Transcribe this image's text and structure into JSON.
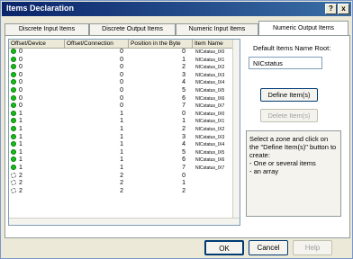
{
  "window": {
    "title": "Items Declaration",
    "help_glyph": "?",
    "close_glyph": "x"
  },
  "tabs": [
    {
      "label": "Discrete Input Items"
    },
    {
      "label": "Discrete Output Items"
    },
    {
      "label": "Numeric Input Items"
    },
    {
      "label": "Numeric Output Items"
    }
  ],
  "active_tab": "Numeric Output Items",
  "grid": {
    "columns": [
      "Offset/Device",
      "Offset/Connection",
      "Position in the Byte",
      "Item Name"
    ],
    "rows": [
      {
        "status": "green",
        "device": "0",
        "conn": "0",
        "pos": "0",
        "name": "NICstatus_IX0"
      },
      {
        "status": "green",
        "device": "0",
        "conn": "0",
        "pos": "1",
        "name": "NICstatus_IX1"
      },
      {
        "status": "green",
        "device": "0",
        "conn": "0",
        "pos": "2",
        "name": "NICstatus_IX2"
      },
      {
        "status": "green",
        "device": "0",
        "conn": "0",
        "pos": "3",
        "name": "NICstatus_IX3"
      },
      {
        "status": "green",
        "device": "0",
        "conn": "0",
        "pos": "4",
        "name": "NICstatus_IX4"
      },
      {
        "status": "green",
        "device": "0",
        "conn": "0",
        "pos": "5",
        "name": "NICstatus_IX5"
      },
      {
        "status": "green",
        "device": "0",
        "conn": "0",
        "pos": "6",
        "name": "NICstatus_IX6"
      },
      {
        "status": "green",
        "device": "0",
        "conn": "0",
        "pos": "7",
        "name": "NICstatus_IX7"
      },
      {
        "status": "green",
        "device": "1",
        "conn": "1",
        "pos": "0",
        "name": "NICstatus_IX0"
      },
      {
        "status": "green",
        "device": "1",
        "conn": "1",
        "pos": "1",
        "name": "NICstatus_IX1"
      },
      {
        "status": "green",
        "device": "1",
        "conn": "1",
        "pos": "2",
        "name": "NICstatus_IX2"
      },
      {
        "status": "green",
        "device": "1",
        "conn": "1",
        "pos": "3",
        "name": "NICstatus_IX3"
      },
      {
        "status": "green",
        "device": "1",
        "conn": "1",
        "pos": "4",
        "name": "NICstatus_IX4"
      },
      {
        "status": "green",
        "device": "1",
        "conn": "1",
        "pos": "5",
        "name": "NICstatus_IX5"
      },
      {
        "status": "green",
        "device": "1",
        "conn": "1",
        "pos": "6",
        "name": "NICstatus_IX6"
      },
      {
        "status": "green",
        "device": "1",
        "conn": "1",
        "pos": "7",
        "name": "NICstatus_IX7"
      },
      {
        "status": "empty",
        "device": "2",
        "conn": "2",
        "pos": "0",
        "name": ""
      },
      {
        "status": "empty",
        "device": "2",
        "conn": "2",
        "pos": "1",
        "name": ""
      },
      {
        "status": "empty",
        "device": "2",
        "conn": "2",
        "pos": "2",
        "name": ""
      }
    ]
  },
  "right": {
    "root_label": "Default Items Name Root:",
    "root_value": "NICstatus",
    "define_label": "Define Item(s)",
    "delete_label": "Delete Item(s)",
    "help_text": "Select a zone and click on the \"Define Item(s)\" button to create:\n- One or several items\n- an array"
  },
  "buttons": {
    "ok": "OK",
    "cancel": "Cancel",
    "help": "Help"
  },
  "colors": {
    "status_green": "#13c013",
    "title_bar": "#0a246a"
  }
}
